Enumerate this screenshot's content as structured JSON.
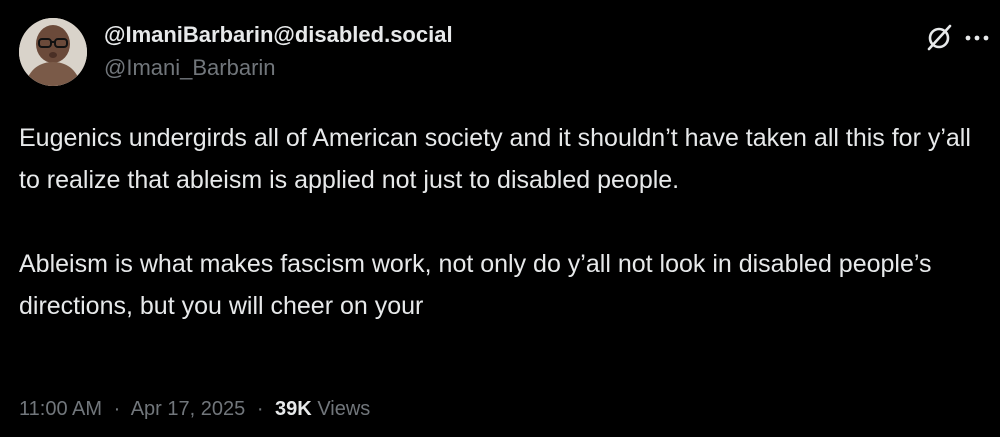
{
  "post": {
    "author": {
      "display_name": "@ImaniBarbarin@disabled.social",
      "handle": "@Imani_Barbarin",
      "avatar_icon": "profile-photo"
    },
    "icons": {
      "grok": "grok-icon",
      "more": "more-options-icon"
    },
    "paragraphs": [
      "Eugenics undergirds all of American society and it shouldn’t have taken all this for y’all to realize that ableism is applied not just to disabled people.",
      "Ableism is what makes fascism work, not only do y’all not look in disabled people’s directions, but you will cheer on your"
    ],
    "meta": {
      "time": "11:00 AM",
      "separator": "·",
      "date": "Apr 17, 2025",
      "views_count": "39K",
      "views_label": "Views"
    }
  },
  "colors": {
    "background": "#000000",
    "primary_text": "#e7e9ea",
    "secondary_text": "#71767b"
  }
}
